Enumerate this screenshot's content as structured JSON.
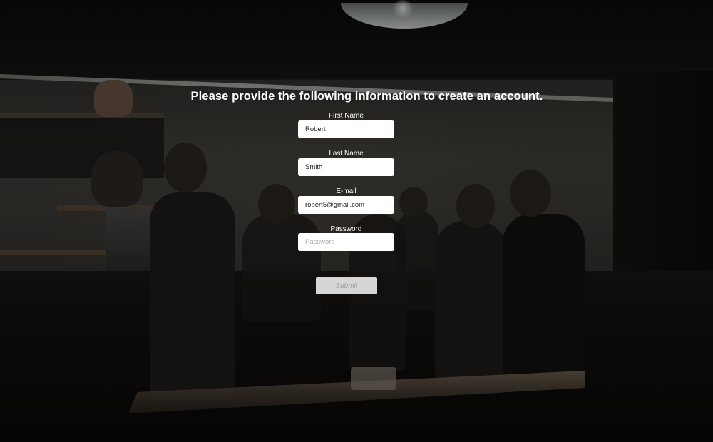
{
  "form": {
    "title": "Please provide the following information to create an account.",
    "fields": [
      {
        "label": "First Name",
        "value": "Robert",
        "placeholder": ""
      },
      {
        "label": "Last Name",
        "value": "Smith",
        "placeholder": ""
      },
      {
        "label": "E-mail",
        "value": "robert5@gmail.com",
        "placeholder": ""
      },
      {
        "label": "Password",
        "value": "",
        "placeholder": "Password"
      }
    ],
    "submit_label": "Submit"
  }
}
